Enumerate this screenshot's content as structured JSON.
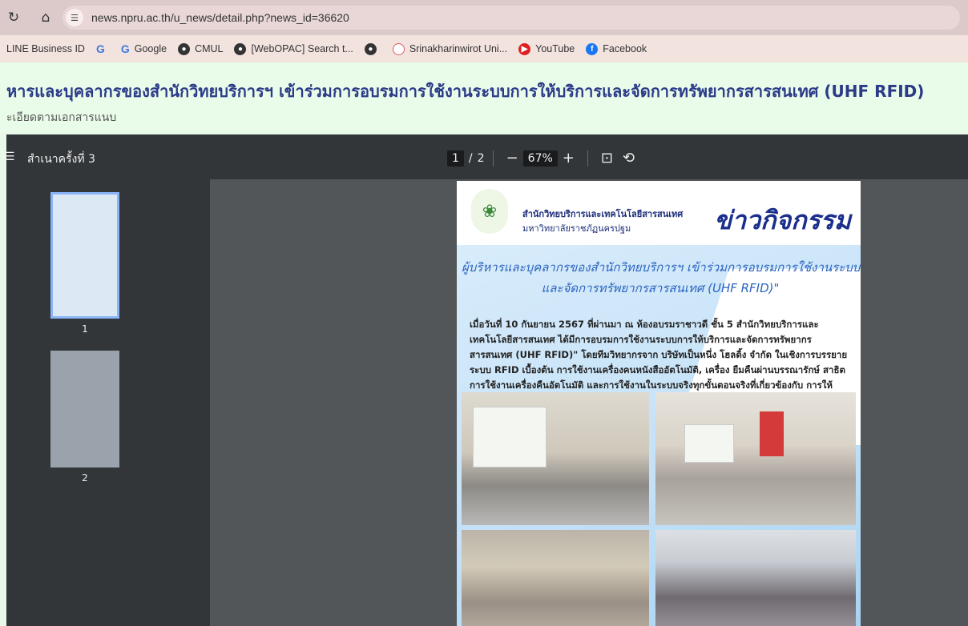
{
  "address_bar": {
    "reload_icon": "reload-icon",
    "home_icon": "home-icon",
    "url": "news.npru.ac.th/u_news/detail.php?news_id=36620"
  },
  "bookmarks": [
    {
      "label": "LINE Business ID",
      "icon": "none"
    },
    {
      "label": "",
      "icon": "google-icon"
    },
    {
      "label": "Google",
      "icon": "google-icon"
    },
    {
      "label": "CMUL",
      "icon": "globe-icon"
    },
    {
      "label": "[WebOPAC] Search t...",
      "icon": "globe-icon"
    },
    {
      "label": "",
      "icon": "globe-icon"
    },
    {
      "label": "Srinakharinwirot Uni...",
      "icon": "swu-icon"
    },
    {
      "label": "YouTube",
      "icon": "youtube-icon"
    },
    {
      "label": "Facebook",
      "icon": "facebook-icon"
    }
  ],
  "news": {
    "title": "หารและบุคลากรของสำนักวิทยบริการฯ เข้าร่วมการอบรมการใช้งานระบบการให้บริการและจัดการทรัพยากรสารสนเทศ (UHF RFID)",
    "subtitle": "ะเอียดตามเอกสารแนบ"
  },
  "viewer": {
    "doc_title": "สำเนาครั้งที่ 3",
    "current_page": "1",
    "page_sep": "/",
    "total_pages": "2",
    "zoom": "67%",
    "thumbnails": [
      "1",
      "2"
    ]
  },
  "pdf_page": {
    "org_line1": "สำนักวิทยบริการและเทคโนโลยีสารสนเทศ",
    "org_line2": "มหาวิทยาลัยราชภัฏนครปฐม",
    "brand": "ข่าวกิจกรรม",
    "headline1": "ผู้บริหารและบุคลากรของสำนักวิทยบริการฯ เข้าร่วมการอบรมการใช้งานระบบการให้บริการ",
    "headline2": "และจัดการทรัพยากรสารสนเทศ (UHF RFID)\"",
    "body": "เมื่อวันที่ 10 กันยายน 2567 ที่ผ่านมา ณ ห้องอบรมราชาวดี ชั้น 5 สำนักวิทยบริการและเทคโนโลยีสารสนเทศ ได้มีการอบรมการใช้งานระบบการให้บริการและจัดการทรัพยากรสารสนเทศ (UHF RFID)\" โดยทีมวิทยากรจาก บริษัทเป็นหนึ่ง โฮลดิ้ง จำกัด ในเชิงการบรรยาย ระบบ RFID เบื้องต้น การใช้งานเครื่องคนหนังสืออัตโนมัติ, เครื่อง ยืมคืนผ่านบรรณารักษ์ สาธิตการใช้งานเครื่องคืนอัตโนมัติ และการใช้งานในระบบจริงทุกขั้นตอนจริงที่เกี่ยวข้องกับ การให้บริการต่อไป"
  },
  "colors": {
    "title": "#2a3a88",
    "viewer_bg": "#525659",
    "toolbar_bg": "#323639",
    "brand": "#1a2f8c"
  }
}
